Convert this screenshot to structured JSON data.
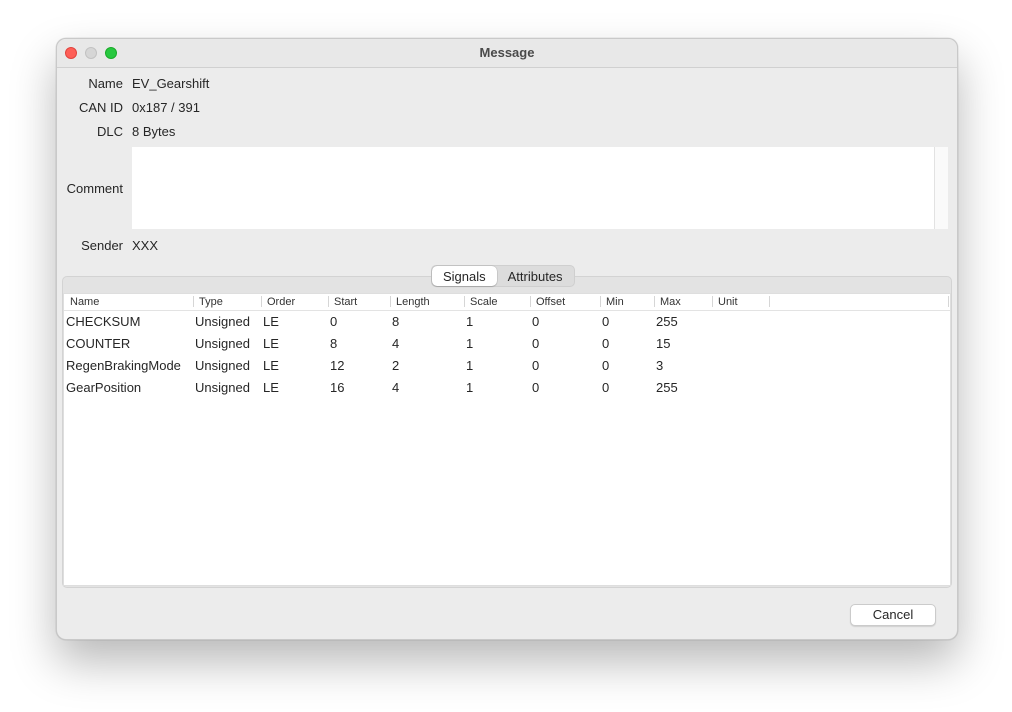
{
  "window": {
    "title": "Message"
  },
  "form": {
    "name_label": "Name",
    "name_value": "EV_Gearshift",
    "canid_label": "CAN ID",
    "canid_value": "0x187 / 391",
    "dlc_label": "DLC",
    "dlc_value": "8 Bytes",
    "comment_label": "Comment",
    "comment_value": "",
    "sender_label": "Sender",
    "sender_value": "XXX"
  },
  "tabs": [
    {
      "label": "Signals",
      "active": true
    },
    {
      "label": "Attributes",
      "active": false
    }
  ],
  "table": {
    "columns": [
      "Name",
      "Type",
      "Order",
      "Start",
      "Length",
      "Scale",
      "Offset",
      "Min",
      "Max",
      "Unit"
    ],
    "rows": [
      [
        "CHECKSUM",
        "Unsigned",
        "LE",
        "0",
        "8",
        "1",
        "0",
        "0",
        "255",
        ""
      ],
      [
        "COUNTER",
        "Unsigned",
        "LE",
        "8",
        "4",
        "1",
        "0",
        "0",
        "15",
        ""
      ],
      [
        "RegenBrakingMode",
        "Unsigned",
        "LE",
        "12",
        "2",
        "1",
        "0",
        "0",
        "3",
        ""
      ],
      [
        "GearPosition",
        "Unsigned",
        "LE",
        "16",
        "4",
        "1",
        "0",
        "0",
        "255",
        ""
      ]
    ]
  },
  "buttons": {
    "cancel": "Cancel"
  }
}
